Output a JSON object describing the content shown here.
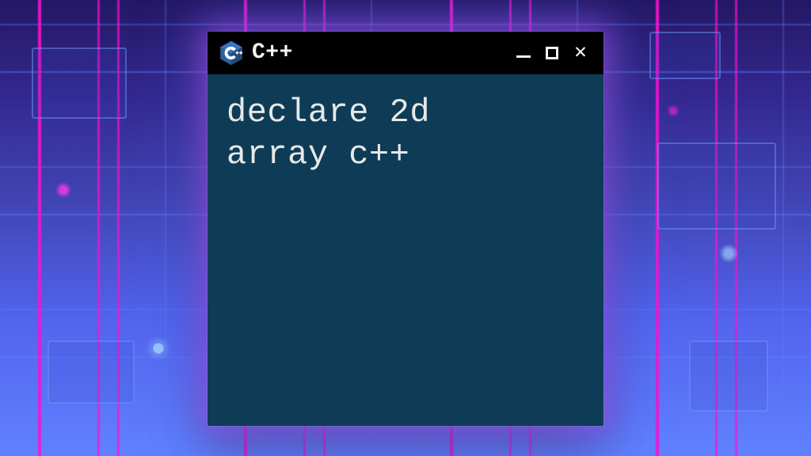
{
  "window": {
    "title": "C++",
    "icon_name": "cpp-icon",
    "controls": {
      "minimize": "minimize",
      "maximize": "maximize",
      "close": "close"
    }
  },
  "body": {
    "code_line_1": "declare 2d",
    "code_line_2": "array c++"
  },
  "colors": {
    "window_bg": "#0e3c57",
    "titlebar_bg": "#000000",
    "text": "#e8e8e8",
    "glow": "#be50ff"
  }
}
